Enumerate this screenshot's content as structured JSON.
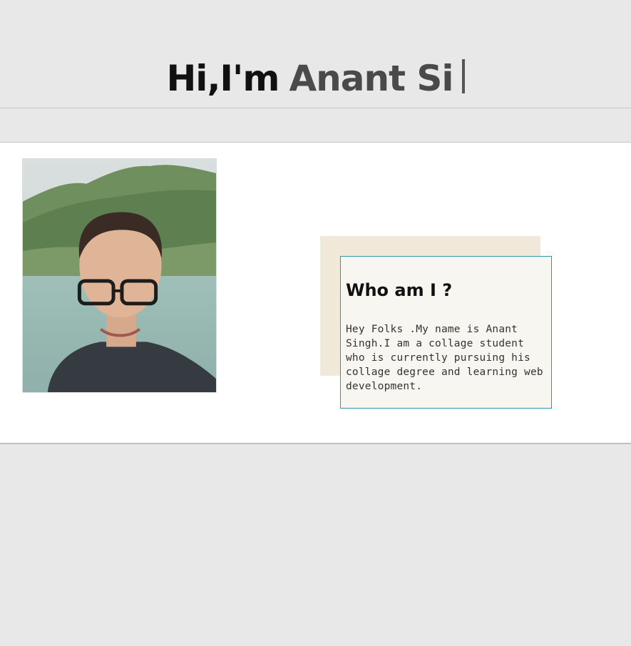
{
  "hero": {
    "greeting": "Hi,I'm",
    "typed_name": "Anant Si"
  },
  "about": {
    "photo_alt": "Anant Singh",
    "heading": "Who am I ?",
    "body": "Hey Folks .My name is Anant Singh.I am a collage student who is currently pursuing his collage degree and learning web development."
  },
  "colors": {
    "page_background": "#e8e8e8",
    "section_background": "#ffffff",
    "card_border": "#2a9aa8",
    "card_background": "#f8f6f1",
    "card_backdrop": "#f0e8d8",
    "greeting_text": "#111111",
    "name_text": "#4a4a4a"
  }
}
